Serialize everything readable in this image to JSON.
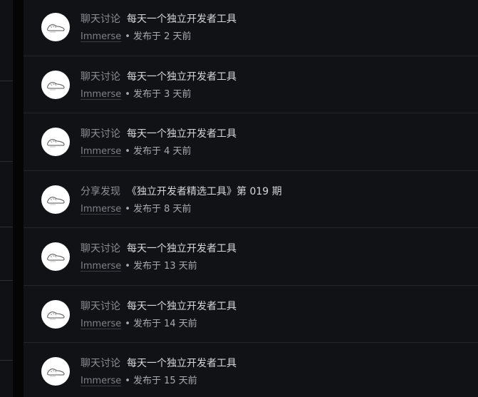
{
  "author_avatar_icon": "shoe-sketch-icon",
  "colors": {
    "background": "#0b0b0d",
    "row_background": "#111215",
    "row_divider": "#23252a",
    "category_text": "#8c8f94",
    "title_text": "#d6d8db",
    "meta_text": "#a8abb0"
  },
  "posts": [
    {
      "category": "聊天讨论",
      "title": "每天一个独立开发者工具",
      "author": "Immerse",
      "separator": "•",
      "time": "发布于 2 天前"
    },
    {
      "category": "聊天讨论",
      "title": "每天一个独立开发者工具",
      "author": "Immerse",
      "separator": "•",
      "time": "发布于 3 天前"
    },
    {
      "category": "聊天讨论",
      "title": "每天一个独立开发者工具",
      "author": "Immerse",
      "separator": "•",
      "time": "发布于 4 天前"
    },
    {
      "category": "分享发现",
      "title": "《独立开发者精选工具》第 019 期",
      "author": "Immerse",
      "separator": "•",
      "time": "发布于 8 天前"
    },
    {
      "category": "聊天讨论",
      "title": "每天一个独立开发者工具",
      "author": "Immerse",
      "separator": "•",
      "time": "发布于 13 天前"
    },
    {
      "category": "聊天讨论",
      "title": "每天一个独立开发者工具",
      "author": "Immerse",
      "separator": "•",
      "time": "发布于 14 天前"
    },
    {
      "category": "聊天讨论",
      "title": "每天一个独立开发者工具",
      "author": "Immerse",
      "separator": "•",
      "time": "发布于 15 天前"
    }
  ]
}
